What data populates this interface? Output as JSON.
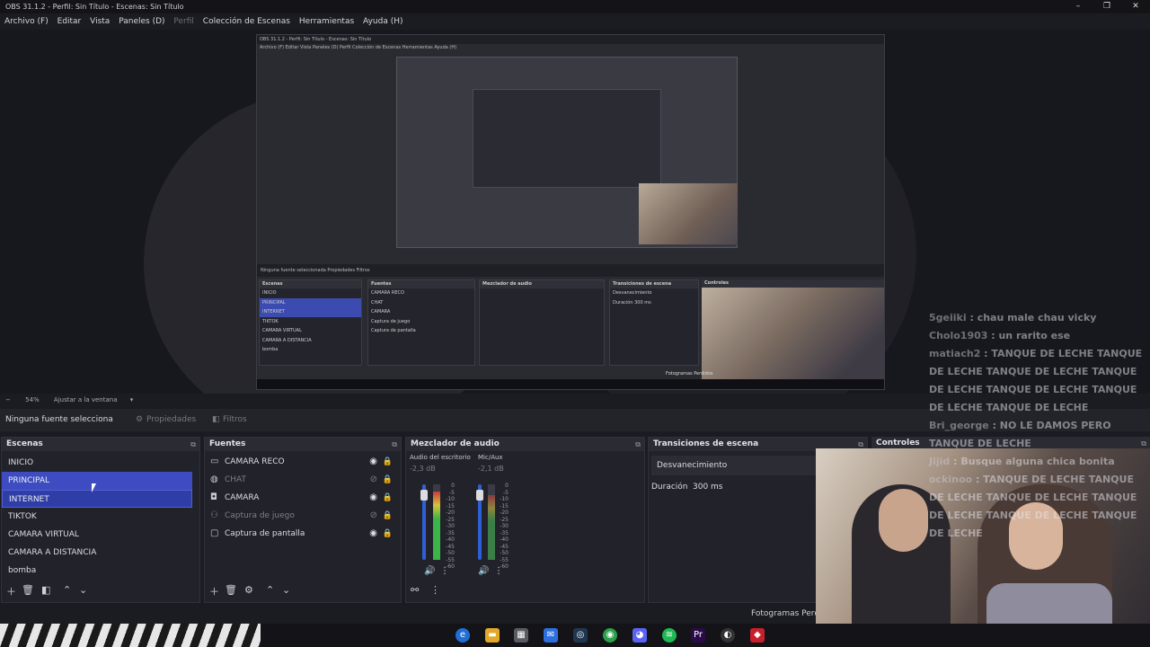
{
  "window": {
    "title": "OBS 31.1.2 - Perfil: Sin Título - Escenas: Sin Título"
  },
  "menu": [
    {
      "label": "Archivo (F)",
      "enabled": true
    },
    {
      "label": "Editar",
      "enabled": true
    },
    {
      "label": "Vista",
      "enabled": true
    },
    {
      "label": "Paneles (D)",
      "enabled": true
    },
    {
      "label": "Perfil",
      "enabled": false
    },
    {
      "label": "Colección de Escenas",
      "enabled": true
    },
    {
      "label": "Herramientas",
      "enabled": true
    },
    {
      "label": "Ayuda (H)",
      "enabled": true
    }
  ],
  "preview": {
    "nested_title": "OBS 31.1.2 - Perfil: Sin Título - Escenas: Sin Título",
    "nested_menu": "Archivo (F)   Editar   Vista   Paneles (D)   Perfil   Colección de Escenas   Herramientas   Ayuda (H)",
    "nested_bar": "Ninguna fuente seleccionada      Propiedades      Filtros",
    "nested_scenes_header": "Escenas",
    "nested_scenes": [
      "INICIO",
      "PRINCIPAL",
      "INTERNET",
      "TIKTOK",
      "CAMARA VIRTUAL",
      "CAMARA A DISTANCIA",
      "bomba"
    ],
    "nested_sources_header": "Fuentes",
    "nested_sources": [
      "CAMARA RECO",
      "CHAT",
      "CAMARA",
      "Captura de juego",
      "Captura de pantalla"
    ],
    "nested_mixer_header": "Mezclador de audio",
    "nested_trans_header": "Transiciones de escena",
    "nested_trans_value": "Desvanecimiento",
    "nested_duration": "Duración   300 ms",
    "nested_controls_header": "Controles",
    "nested_fps": "Fotogramas Perdidos"
  },
  "zoom": {
    "minus": "−",
    "value": "54%",
    "fit": "Ajustar a la ventana",
    "chevron": "▾"
  },
  "source_toolbar": {
    "none_selected": "Ninguna fuente selecciona",
    "properties": "Propiedades",
    "filters": "Filtros",
    "properties_icon": "gear-icon",
    "filters_icon": "filter-icon"
  },
  "scenes": {
    "header": "Escenas",
    "items": [
      {
        "label": "INICIO",
        "state": "normal"
      },
      {
        "label": "PRINCIPAL",
        "state": "selected"
      },
      {
        "label": "INTERNET",
        "state": "selected-outline"
      },
      {
        "label": "TIKTOK",
        "state": "normal"
      },
      {
        "label": "CAMARA VIRTUAL",
        "state": "normal"
      },
      {
        "label": "CAMARA A DISTANCIA",
        "state": "normal"
      },
      {
        "label": "bomba",
        "state": "normal"
      }
    ]
  },
  "sources": {
    "header": "Fuentes",
    "items": [
      {
        "label": "CAMARA RECO",
        "icon": "window-icon",
        "visible": true
      },
      {
        "label": "CHAT",
        "icon": "browser-icon",
        "visible": false
      },
      {
        "label": "CAMARA",
        "icon": "camera-icon",
        "visible": true
      },
      {
        "label": "Captura de juego",
        "icon": "gamepad-icon",
        "visible": false
      },
      {
        "label": "Captura de pantalla",
        "icon": "monitor-icon",
        "visible": true
      }
    ]
  },
  "mixer": {
    "header": "Mezclador de audio",
    "channels": [
      {
        "name": "Audio del escritorio",
        "db": "-2,3 dB",
        "level": 0.9
      },
      {
        "name": "Mic/Aux",
        "db": "-2,1 dB",
        "level": 0.86
      }
    ],
    "scale": [
      "0",
      "-5",
      "-10",
      "-15",
      "-20",
      "-25",
      "-30",
      "-35",
      "-40",
      "-45",
      "-50",
      "-55",
      "-60"
    ]
  },
  "transitions": {
    "header": "Transiciones de escena",
    "value": "Desvanecimiento",
    "duration_label": "Duración",
    "duration_value": "300 ms"
  },
  "controls": {
    "header": "Controles"
  },
  "status": {
    "fps": "Fotogramas Perdid"
  },
  "chat": [
    {
      "user": "5geiiki",
      "msg": "chau male chau vicky"
    },
    {
      "user": "Cholo1903",
      "msg": "un rarito ese"
    },
    {
      "user": "matiach2",
      "msg": "TANQUE DE LECHE TANQUE DE LECHE TANQUE DE LECHE TANQUE DE LECHE TANQUE DE LECHE TANQUE DE LECHE TANQUE DE LECHE"
    },
    {
      "user": "Bri_george",
      "msg": "NO LE DAMOS PERO TANQUE DE LECHE"
    },
    {
      "user": "Jijid",
      "msg": "Busque alguna chica bonita"
    },
    {
      "user": "ockinoo",
      "msg": "TANQUE DE LECHE TANQUE DE LECHE TANQUE DE LECHE TANQUE DE LECHE TANQUE DE LECHE TANQUE DE LECHE"
    }
  ],
  "colors": {
    "accent": "#3d4cc0",
    "panel": "#22232a",
    "meter_green": "#3bb54a"
  }
}
